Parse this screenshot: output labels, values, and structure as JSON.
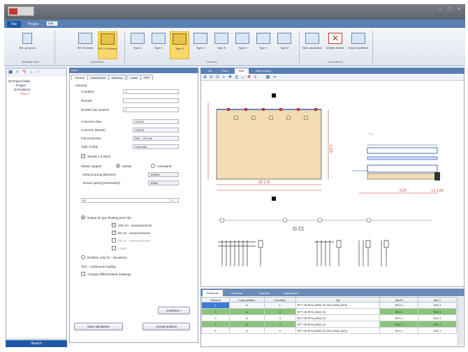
{
  "window": {
    "title": ""
  },
  "ribbon": {
    "tabs": [
      {
        "label": "File",
        "state": "active"
      },
      {
        "label": "Project",
        "state": "normal"
      },
      {
        "label": "Edit",
        "state": "selected"
      }
    ],
    "groups": [
      {
        "label": "Manage code",
        "buttons": [
          "Set up specs"
        ]
      },
      {
        "label": "Calculation",
        "buttons": [
          "RF 2B beam",
          "RF 2 LB beam"
        ]
      },
      {
        "label": "Sections",
        "buttons": [
          "Type 1",
          "Type 2",
          "Type 3",
          "Type 4",
          "Type 5",
          "Type 6",
          "Type 7",
          "Type 8"
        ]
      },
      {
        "label": "Calculations",
        "buttons": [
          "New calculation",
          "Delete results",
          "Export workflow"
        ]
      }
    ]
  },
  "tree": {
    "nodes": [
      "Project folder",
      "Project",
      "Positions",
      "Pos 1"
    ],
    "bottom_label": "Search"
  },
  "panel": {
    "header": "Input",
    "tabs": [
      "General",
      "Dimensions",
      "Masonry",
      "Loads",
      "FRP"
    ],
    "section_general": "General",
    "fields": [
      {
        "label": "Condition",
        "value": "1"
      },
      {
        "label": "Remark",
        "value": ""
      },
      {
        "label": "Number per position",
        "value": "1"
      }
    ],
    "selects": [
      {
        "label": "Concrete class",
        "value": "C20/25"
      },
      {
        "label": "Concrete (above)",
        "value": "C20/25"
      },
      {
        "label": "Fire protection",
        "value": "R60 - 120 min"
      },
      {
        "label": "Type of slab",
        "value": "Solid slab"
      }
    ],
    "slab_check": "Steady 1.5 kN/m",
    "support_label": "Elastic support",
    "support_default": "default",
    "support_calc": "calculated",
    "spring_fields": [
      {
        "label": "Vertical spring [kN/m/m]",
        "value": "100000"
      },
      {
        "label": "Torsion spring [kNm/rad/m]",
        "value": "10000"
      }
    ],
    "load_field": "ID",
    "output_label": "Output ID (per floating point ID)",
    "output_options": [
      {
        "label": "100 cm - measurements",
        "checked": true
      },
      {
        "label": "50 cm - measurements",
        "checked": true
      },
      {
        "label": "25 cm - measurements",
        "checked": false
      },
      {
        "label": "Loads",
        "checked": false
      }
    ],
    "only_label": "Emittery only for - elevations",
    "next_section": "Text - continuous loading",
    "arrange_check": "Arrange differentiated drawings",
    "continue_btn": "Continue »",
    "new_calc_btn": "New calculation",
    "accept_btn": "Accept position"
  },
  "drawing": {
    "tabs": [
      "3D",
      "Plan",
      "Elev",
      "Side section"
    ],
    "active_tab": 2,
    "dims": [
      "1.120",
      "30 1 22",
      "2.20",
      "L1 1.00"
    ],
    "label_text": "1.1"
  },
  "results": {
    "tabs": [
      "Elements",
      "Positions",
      "Intervals",
      "Assignment"
    ],
    "columns": [
      "Element",
      "Load position",
      "Condition",
      "Typ",
      "abs M",
      "abs V"
    ],
    "rows": [
      {
        "element": "1",
        "load_position": "A",
        "condition": "1",
        "typ": "RFT 2B RF8 (4000) 20 330 (4000) (320)",
        "absm": "99.0 1",
        "absv": "40.5 1",
        "style": "sel"
      },
      {
        "element": "2",
        "load_position": "A",
        "condition": "2",
        "typ": "RFT 2B RF8 (4000) 20",
        "absm": "99.0 1",
        "absv": "39.0 1",
        "style": "g"
      },
      {
        "element": "3",
        "load_position": "A",
        "condition": "3",
        "typ": "RFT 2B RF8 (4000) 20",
        "absm": "99.0 1",
        "absv": "39.0 1",
        "style": "n"
      },
      {
        "element": "4",
        "load_position": "A",
        "condition": "4",
        "typ": "RFT 2B RF8 (4000) 20",
        "absm": "99.0 1",
        "absv": "40.5 1",
        "style": "g"
      },
      {
        "element": "5",
        "load_position": "A",
        "condition": "5",
        "typ": "RFT 2B RF8 (4000) 20 330 (4000) (320)",
        "absm": "99.0 1",
        "absv": "40.5 1",
        "style": "n"
      }
    ]
  },
  "colors": {
    "accent": "#1e57a8",
    "highlight_row": "#8cc47a",
    "ribbon_highlight": "#f9d86d"
  }
}
